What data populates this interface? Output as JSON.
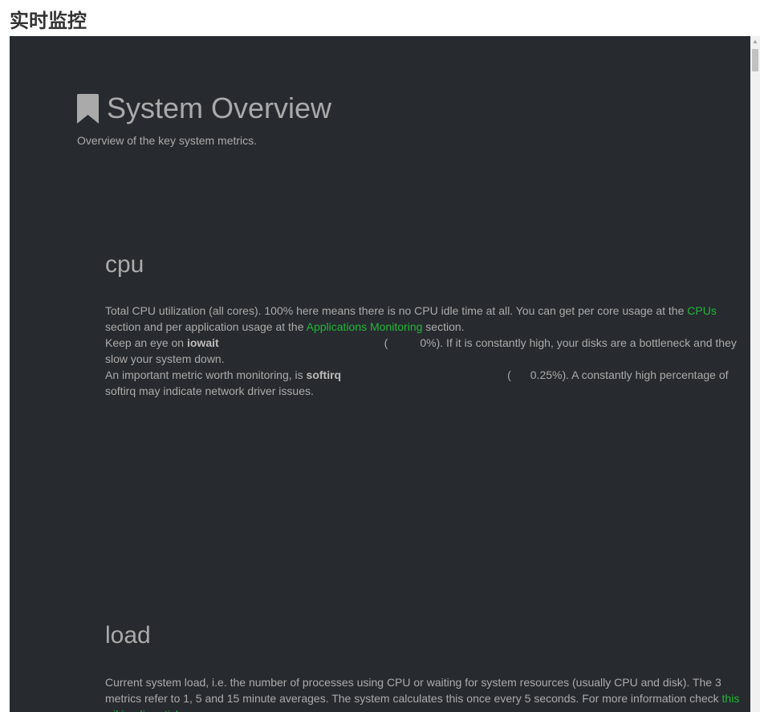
{
  "page": {
    "title": "实时监控"
  },
  "overview": {
    "title": "System Overview",
    "subtitle": "Overview of the key system metrics."
  },
  "cpu": {
    "title": "cpu",
    "p1_a": "Total CPU utilization (all cores). 100% here means there is no CPU idle time at all. You can get per core usage at the ",
    "p1_link1": "CPUs",
    "p1_b": " section and per application usage at the ",
    "p1_link2": "Applications Monitoring",
    "p1_c": " section.",
    "p2_a": "Keep an eye on ",
    "p2_bold": "iowait",
    "p2_paren": "(",
    "p2_value": "0%",
    "p2_b": "). If it is constantly high, your disks are a bottleneck and they slow your system down.",
    "p3_a": "An important metric worth monitoring, is ",
    "p3_bold": "softirq",
    "p3_paren": "(",
    "p3_value": "0.25%",
    "p3_b": "). A constantly high percentage of softirq may indicate network driver issues."
  },
  "load": {
    "title": "load",
    "p1_a": "Current system load, i.e. the number of processes using CPU or waiting for system resources (usually CPU and disk). The 3 metrics refer to 1, 5 and 15 minute averages. The system calculates this once every 5 seconds. For more information check ",
    "p1_link": "this wikipedia article"
  },
  "colors": {
    "background": "#272b30",
    "text": "#aaaaaa",
    "link": "#22b735"
  },
  "icons": {
    "header": "bookmark-icon"
  }
}
